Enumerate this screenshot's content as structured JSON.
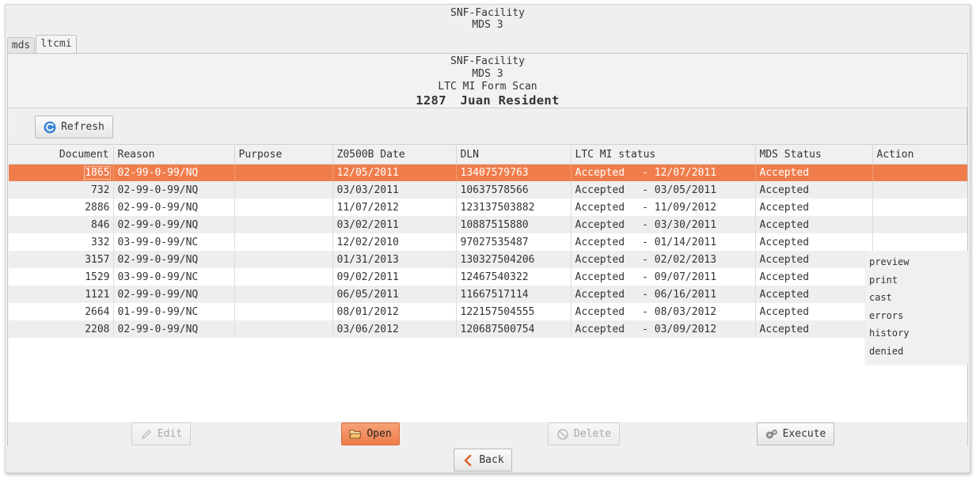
{
  "app": {
    "title_line1": "SNF-Facility",
    "title_line2": "MDS 3"
  },
  "tabs": [
    {
      "label": "mds",
      "active": false
    },
    {
      "label": "ltcmi",
      "active": true
    }
  ],
  "form": {
    "facility": "SNF-Facility",
    "mds": "MDS 3",
    "scan_title": "LTC MI Form Scan",
    "resident_id": "1287",
    "resident_name": "Juan Resident"
  },
  "toolbar": {
    "refresh_label": "Refresh"
  },
  "table": {
    "columns": [
      "Document",
      "Reason",
      "Purpose",
      "Z0500B Date",
      "DLN",
      "LTC MI status",
      "MDS Status",
      "Action"
    ],
    "rows": [
      {
        "document": "1865",
        "reason": "02-99-0-99/NQ",
        "purpose": "",
        "z0500b_date": "12/05/2011",
        "dln": "13407579763",
        "ltc_status": "Accepted",
        "ltc_date": "- 12/07/2011",
        "mds_status": "Accepted",
        "action": ""
      },
      {
        "document": "732",
        "reason": "02-99-0-99/NQ",
        "purpose": "",
        "z0500b_date": "03/03/2011",
        "dln": "10637578566",
        "ltc_status": "Accepted",
        "ltc_date": "- 03/05/2011",
        "mds_status": "Accepted",
        "action": ""
      },
      {
        "document": "2886",
        "reason": "02-99-0-99/NQ",
        "purpose": "",
        "z0500b_date": "11/07/2012",
        "dln": "123137503882",
        "ltc_status": "Accepted",
        "ltc_date": "- 11/09/2012",
        "mds_status": "Accepted",
        "action": ""
      },
      {
        "document": "846",
        "reason": "02-99-0-99/NQ",
        "purpose": "",
        "z0500b_date": "03/02/2011",
        "dln": "10887515880",
        "ltc_status": "Accepted",
        "ltc_date": "- 03/30/2011",
        "mds_status": "Accepted",
        "action": ""
      },
      {
        "document": "332",
        "reason": "03-99-0-99/NC",
        "purpose": "",
        "z0500b_date": "12/02/2010",
        "dln": "97027535487",
        "ltc_status": "Accepted",
        "ltc_date": "- 01/14/2011",
        "mds_status": "Accepted",
        "action": ""
      },
      {
        "document": "3157",
        "reason": "02-99-0-99/NQ",
        "purpose": "",
        "z0500b_date": "01/31/2013",
        "dln": "130327504206",
        "ltc_status": "Accepted",
        "ltc_date": "- 02/02/2013",
        "mds_status": "Accepted",
        "action": ""
      },
      {
        "document": "1529",
        "reason": "03-99-0-99/NC",
        "purpose": "",
        "z0500b_date": "09/02/2011",
        "dln": "12467540322",
        "ltc_status": "Accepted",
        "ltc_date": "- 09/07/2011",
        "mds_status": "Accepted",
        "action": ""
      },
      {
        "document": "1121",
        "reason": "02-99-0-99/NQ",
        "purpose": "",
        "z0500b_date": "06/05/2011",
        "dln": "11667517114",
        "ltc_status": "Accepted",
        "ltc_date": "- 06/16/2011",
        "mds_status": "Accepted",
        "action": ""
      },
      {
        "document": "2664",
        "reason": "01-99-0-99/NC",
        "purpose": "",
        "z0500b_date": "08/01/2012",
        "dln": "122157504555",
        "ltc_status": "Accepted",
        "ltc_date": "- 08/03/2012",
        "mds_status": "Accepted",
        "action": ""
      },
      {
        "document": "2208",
        "reason": "02-99-0-99/NQ",
        "purpose": "",
        "z0500b_date": "03/06/2012",
        "dln": "120687500754",
        "ltc_status": "Accepted",
        "ltc_date": "- 03/09/2012",
        "mds_status": "Accepted",
        "action": ""
      }
    ]
  },
  "action_menu": [
    "preview",
    "print",
    "cast",
    "errors",
    "history",
    "denied"
  ],
  "buttons": {
    "edit": "Edit",
    "open": "Open",
    "delete": "Delete",
    "execute": "Execute",
    "back": "Back"
  },
  "colors": {
    "selected_row": "#ef7d4c",
    "primary_button": "#ee7d4b",
    "refresh_icon": "#3b84d4"
  }
}
